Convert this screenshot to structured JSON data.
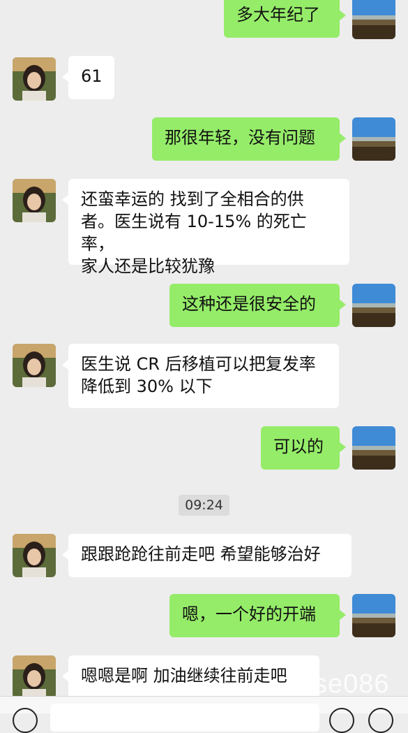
{
  "messages": [
    {
      "side": "right",
      "text": "多大年纪了"
    },
    {
      "side": "left",
      "text": "61"
    },
    {
      "side": "right",
      "text": "那很年轻，没有问题"
    },
    {
      "side": "left",
      "text": "还蛮幸运的 找到了全相合的供\n者。医生说有 10-15% 的死亡率，\n家人还是比较犹豫"
    },
    {
      "side": "right",
      "text": "这种还是很安全的"
    },
    {
      "side": "left",
      "text": "医生说 CR 后移植可以把复发率\n降低到 30% 以下"
    },
    {
      "side": "right",
      "text": "可以的"
    },
    {
      "side": "left",
      "text": "跟跟跄跄往前走吧 希望能够治好"
    },
    {
      "side": "right",
      "text": "嗯，一个好的开端"
    },
    {
      "side": "left",
      "text": "嗯嗯是啊 加油继续往前走吧"
    }
  ],
  "timestamp": "09:24",
  "watermark": "se086",
  "colors": {
    "sent_bubble": "#95ec69",
    "received_bubble": "#ffffff",
    "background": "#ededed"
  },
  "icons": {
    "sender_avatar": "landscape-avatar",
    "receiver_avatar": "woman-avatar"
  }
}
